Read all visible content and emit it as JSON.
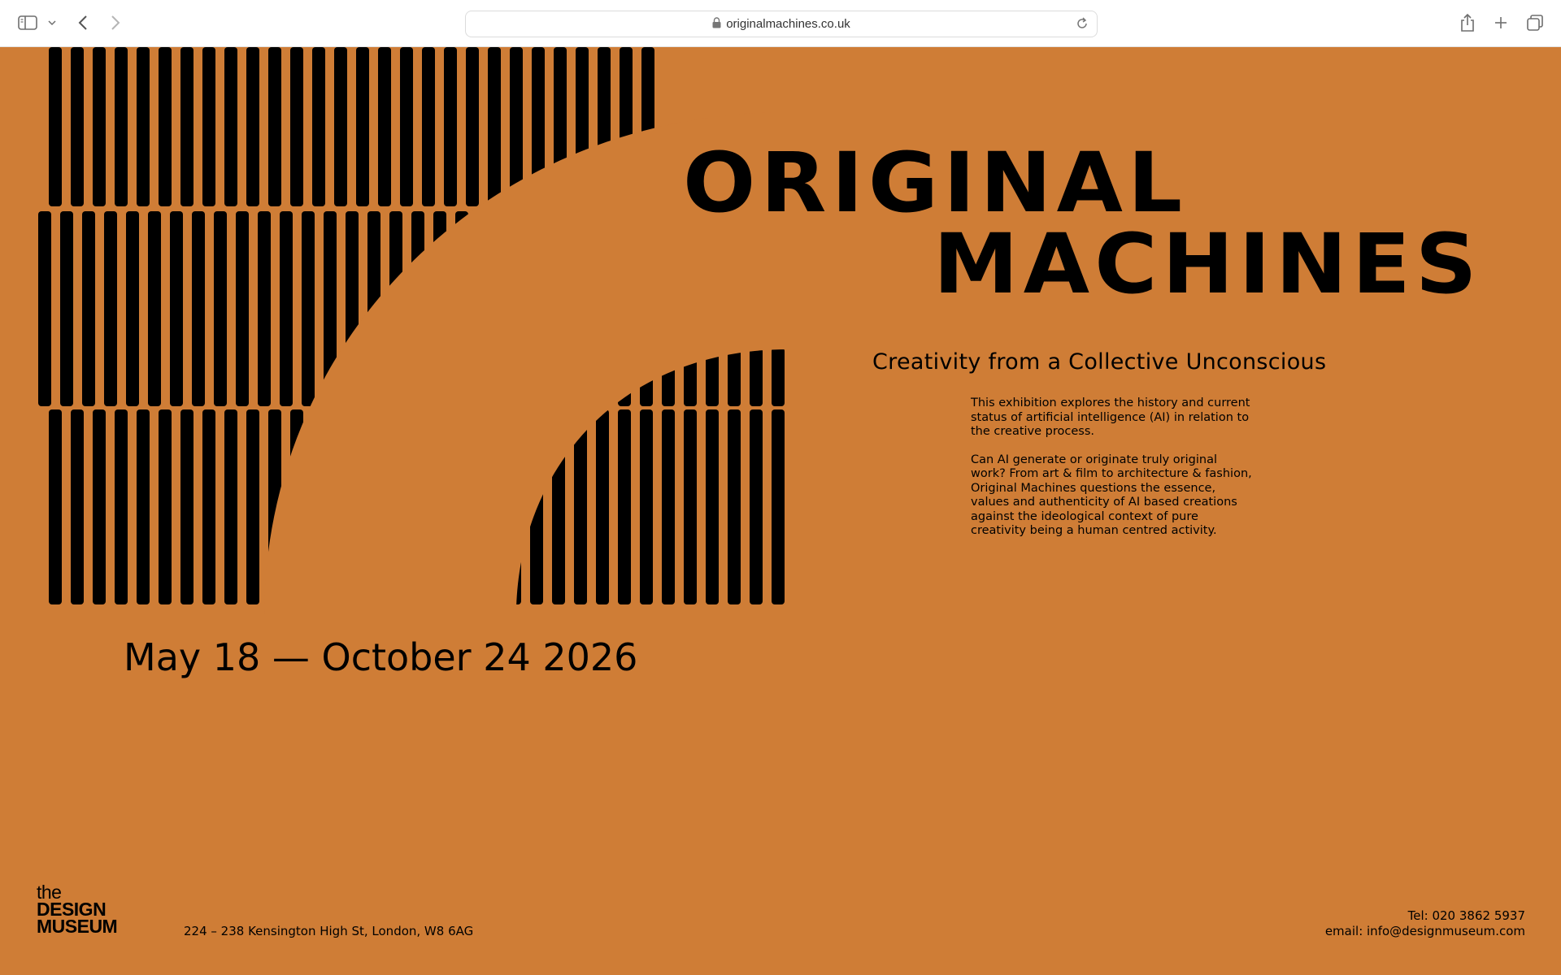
{
  "browser": {
    "url": "originalmachines.co.uk",
    "icons": {
      "sidebar": "sidebar-icon",
      "chevron": "chevron-down-icon",
      "back": "back-arrow-icon",
      "forward": "forward-arrow-icon",
      "lock": "lock-icon",
      "reload": "reload-icon",
      "share": "share-icon",
      "new_tab": "plus-icon",
      "tabs": "tabs-overview-icon"
    }
  },
  "poster": {
    "title_line1": "ORIGINAL",
    "title_line2": "MACHINES",
    "subtitle": "Creativity from a Collective Unconscious",
    "description": [
      "This exhibition explores the history and current status of artificial intelligence (AI) in relation to the creative process.",
      "Can AI generate or originate truly original work? From art & film to architecture & fashion, Original Machines questions the essence, values and authenticity of AI based creations against the ideological context of pure creativity being a human centred activity."
    ],
    "dates": "May 18 — October 24  2026",
    "logo": {
      "line1": "the",
      "line2": "DESIGN",
      "line3": "MUSEUM"
    },
    "address": "224 – 238 Kensington High St, London, W8 6AG",
    "tel": "Tel: 020 3862 5937",
    "email": "email: info@designmuseum.com"
  },
  "colors": {
    "background": "#CF7D36",
    "ink": "#000000"
  }
}
